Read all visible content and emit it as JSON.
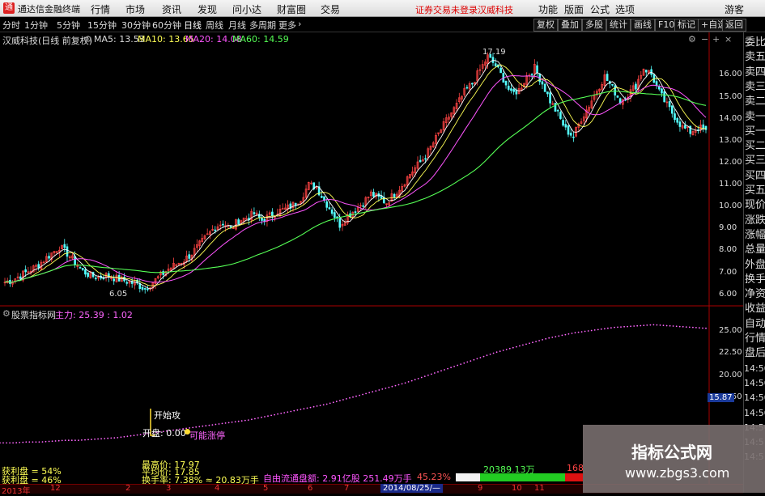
{
  "menubar": {
    "app_title": "通达信金融终端",
    "menus": [
      "行情",
      "市场",
      "资讯",
      "发现",
      "问小达",
      "财富圈",
      "交易"
    ],
    "notice": "证券交易未登录",
    "stock_name": "汉威科技",
    "right_items": [
      "功能",
      "版面",
      "公式",
      "选项"
    ],
    "guest": "游客"
  },
  "periodbar": {
    "periods": [
      "分时",
      "1分钟",
      "5分钟",
      "15分钟",
      "30分钟",
      "60分钟",
      "日线",
      "周线",
      "月线",
      "多周期",
      "更多"
    ],
    "active": "日线",
    "right_buttons": [
      "复权",
      "叠加",
      "多股",
      "统计",
      "画线",
      "F10",
      "标记",
      "+自选",
      "返回"
    ]
  },
  "main_chart": {
    "title": "汉威科技(日线 前复权)",
    "ma": [
      {
        "label": "MA5: 13.53",
        "color": "#ffffff"
      },
      {
        "label": "MA10: 13.65",
        "color": "#ffff55"
      },
      {
        "label": "MA20: 14.08",
        "color": "#ff55ff"
      },
      {
        "label": "MA60: 14.59",
        "color": "#55ff55"
      }
    ],
    "y_ticks": [
      "16.00",
      "15.00",
      "14.00",
      "13.00",
      "12.00",
      "11.00",
      "10.00",
      "9.00",
      "8.00",
      "7.00",
      "6.00"
    ],
    "high_label": "17.19",
    "low_label": "6.05",
    "close_series": [
      6.6,
      6.7,
      6.9,
      7.1,
      7.3,
      7.6,
      7.9,
      8.2,
      7.9,
      7.5,
      7.1,
      6.9,
      6.8,
      6.9,
      6.8,
      6.7,
      6.6,
      6.5,
      6.3,
      6.6,
      6.9,
      7.2,
      7.4,
      7.6,
      7.9,
      8.3,
      8.7,
      9.1,
      9.3,
      9.0,
      9.4,
      9.5,
      9.7,
      9.4,
      9.6,
      9.8,
      9.9,
      10.1,
      10.4,
      11.0,
      10.9,
      10.3,
      9.8,
      9.2,
      9.6,
      9.9,
      10.2,
      10.6,
      10.4,
      10.2,
      10.6,
      11.0,
      11.5,
      11.9,
      12.3,
      12.9,
      13.5,
      14.1,
      14.6,
      15.2,
      15.6,
      16.2,
      16.8,
      16.4,
      15.8,
      15.1,
      15.3,
      15.9,
      16.3,
      15.6,
      14.8,
      14.2,
      13.5,
      13.2,
      14.0,
      14.6,
      15.3,
      15.9,
      15.4,
      14.8,
      15.1,
      15.5,
      16.3,
      16.0,
      15.2,
      14.6,
      14.1,
      13.6,
      13.4,
      13.6,
      13.5
    ]
  },
  "indicator": {
    "title": "股票指标网",
    "zhuli_label": "主力: 25.39 : 1.02",
    "y_ticks": [
      "25.00",
      "22.50",
      "20.00",
      "17.50"
    ],
    "current_value": "15.87",
    "start_label": "开始攻",
    "open_label": "开盘: 0.00",
    "rise_label": "可能涨停",
    "series": [
      12.3,
      12.3,
      12.4,
      12.4,
      12.5,
      12.6,
      12.6,
      12.7,
      12.8,
      12.9,
      13.1,
      13.3,
      13.5,
      13.7,
      13.9,
      14.1,
      14.3,
      14.5,
      14.7,
      14.9,
      15.2,
      15.5,
      15.8,
      16.1,
      16.4,
      16.7,
      17.1,
      17.5,
      17.9,
      18.3,
      18.7,
      19.1,
      19.6,
      20.1,
      20.6,
      21.1,
      21.6,
      22.1,
      22.6,
      23.0,
      23.4,
      23.8,
      24.2,
      24.5,
      24.8,
      25.0,
      25.2,
      25.4,
      25.5,
      25.6,
      25.7,
      25.6,
      25.5,
      25.4,
      25.3
    ]
  },
  "bottom": {
    "profit_ratio": "获利盘 = 54%",
    "chip_ratio": "获利盘 = 46%",
    "min_price": "最高价: 17.97",
    "avg_price": "平均价: 17.85",
    "turnover": "换手率: 7.38% ≈ 20.83万手",
    "overlay_text": "自由流通盘额: 2.91亿股 251.49万手",
    "pct": "45.23%",
    "volume": "20389.13万",
    "vol2": "168"
  },
  "time_axis": [
    "2013年",
    "12",
    "2",
    "3",
    "4",
    "5",
    "6",
    "7",
    "8",
    "9",
    "10",
    "11"
  ],
  "date_box": "2014/08/25/—",
  "right_panel": [
    "委比",
    "卖五",
    "卖四",
    "卖三",
    "卖二",
    "卖一",
    "买一",
    "买二",
    "买三",
    "买四",
    "买五",
    "现价",
    "涨跌",
    "涨幅",
    "总量",
    "外盘",
    "换手",
    "净资",
    "收益",
    "自动",
    "行情",
    "盘后",
    "14:50",
    "14:50",
    "14:50",
    "14:50",
    "14:50",
    "14:51",
    "14:51"
  ],
  "watermark": {
    "line1": "指标公式网",
    "line2": "www.zbgs3.com"
  },
  "colors": {
    "up": "#ff4444",
    "down": "#54ffff",
    "ma5": "#ffffff",
    "ma10": "#ffff55",
    "ma20": "#ff55ff",
    "ma60": "#55ff55",
    "indicator": "#ff66ff"
  }
}
